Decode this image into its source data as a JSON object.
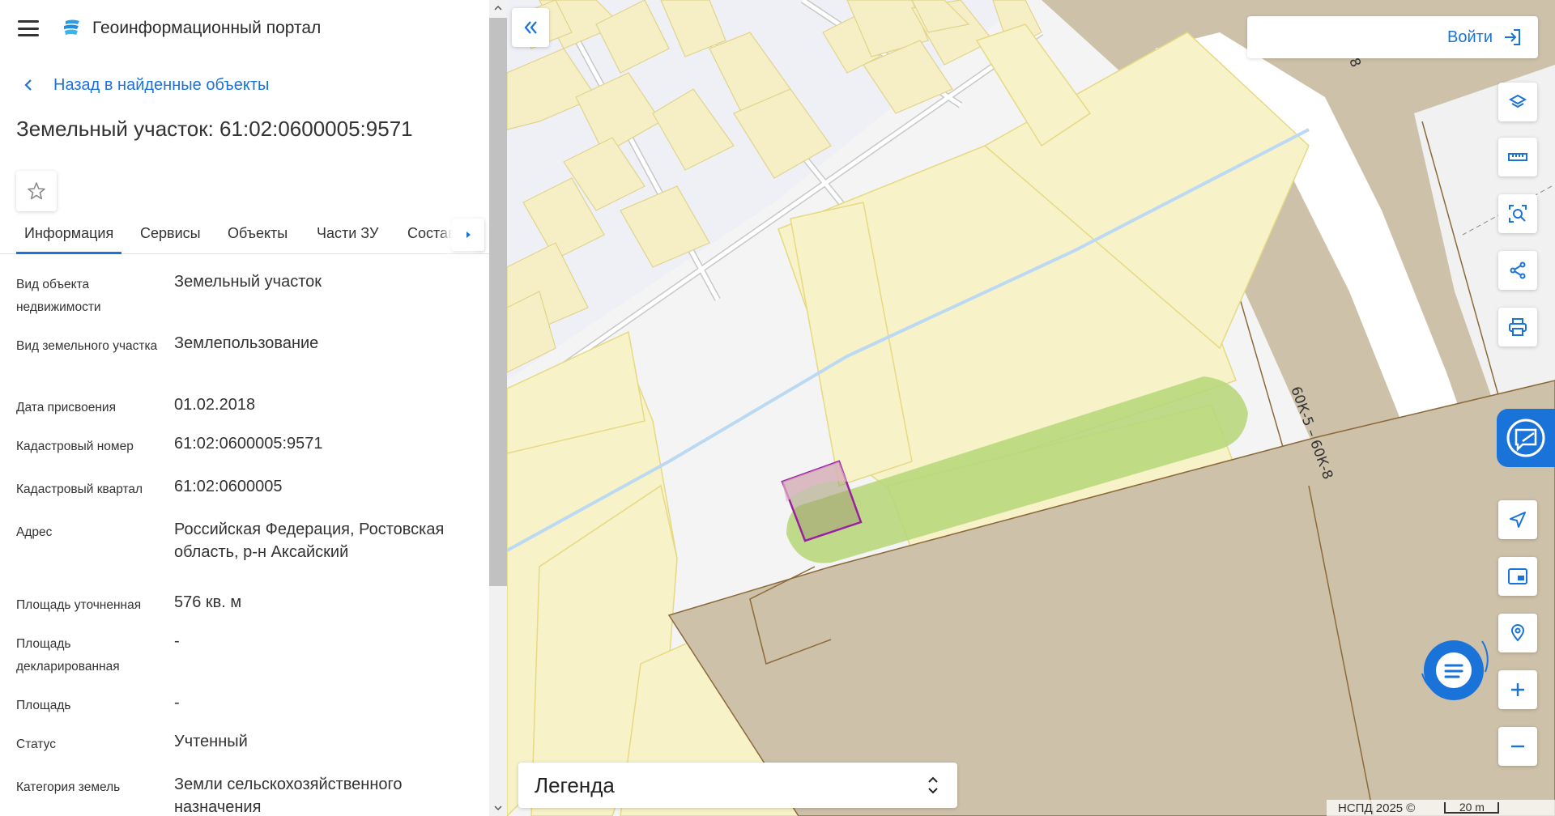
{
  "header": {
    "app_title": "Геоинформационный портал",
    "menu_icon": "hamburger-menu-icon",
    "logo_icon": "portal-logo-icon"
  },
  "back_link": {
    "label": "Назад в найденные объекты"
  },
  "object": {
    "title": "Земельный участок: 61:02:0600005:9571",
    "favorite_icon": "star-outline-icon"
  },
  "tabs": [
    {
      "label": "Информация",
      "active": true
    },
    {
      "label": "Сервисы",
      "active": false
    },
    {
      "label": "Объекты",
      "active": false
    },
    {
      "label": "Части ЗУ",
      "active": false
    },
    {
      "label": "Состав",
      "active": false
    }
  ],
  "properties": [
    {
      "label": "Вид объекта недвижимости",
      "value": "Земельный участок"
    },
    {
      "label": "Вид земельного участка",
      "value": "Землепользование"
    },
    {
      "label": "Дата присвоения",
      "value": "01.02.2018"
    },
    {
      "label": "Кадастровый номер",
      "value": "61:02:0600005:9571"
    },
    {
      "label": "Кадастровый квартал",
      "value": "61:02:0600005"
    },
    {
      "label": "Адрес",
      "value": "Российская Федерация, Ростовская область, р-н Аксайский"
    },
    {
      "label": "Площадь уточненная",
      "value": "576 кв. м"
    },
    {
      "label": "Площадь декларированная",
      "value": "-"
    },
    {
      "label": "Площадь",
      "value": "-"
    },
    {
      "label": "Статус",
      "value": "Учтенный"
    },
    {
      "label": "Категория земель",
      "value": "Земли сельскохозяйственного назначения"
    }
  ],
  "map": {
    "login_label": "Войти",
    "legend_label": "Легенда",
    "road_label": "60К-5 – 60К-8",
    "road_label_top": "8",
    "attribution": "НСПД 2025 ©",
    "scale_label": "20 m",
    "tools": [
      "layers-icon",
      "ruler-icon",
      "area-search-icon",
      "share-icon",
      "print-icon",
      "navigate-icon",
      "minimap-icon",
      "location-search-icon",
      "zoom-in-icon",
      "zoom-out-icon"
    ],
    "colors": {
      "accent": "#1a73d9",
      "parcel_fill": "#f7f2c8",
      "parcel_stroke": "#e6d983",
      "building": "#ccc0a8",
      "road": "#ffffff",
      "green_zone": "#b7d77a",
      "selection": "#9b1fa0"
    }
  }
}
